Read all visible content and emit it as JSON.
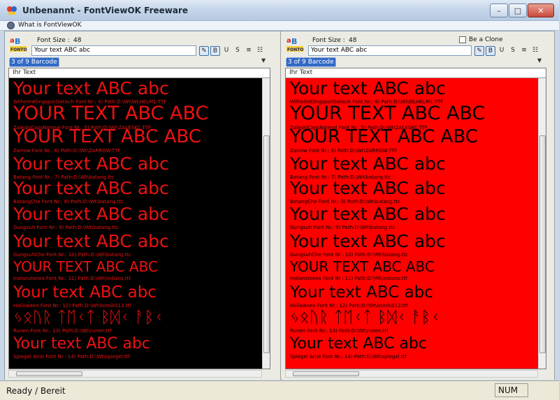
{
  "window": {
    "title": "Unbenannt - FontViewOK Freeware",
    "minimize": "–",
    "maximize": "□",
    "close": "✕"
  },
  "menu": {
    "item": "What is FontViewOK"
  },
  "logo_text": "FONTOK",
  "left": {
    "font_size_label": "Font Size :",
    "font_size_value": "48",
    "text_value": "Your text ABC abc",
    "combo_value": "3 of 9 Barcode",
    "preview_header": "Ihr Text",
    "bg": "#000000",
    "fg": "#ee1111",
    "info_color": "#ee1111"
  },
  "right": {
    "font_size_label": "Font Size :",
    "font_size_value": "48",
    "clone_label": "Be a Clone",
    "text_value": "Your text ABC abc",
    "combo_value": "3 of 9 Barcode",
    "preview_header": "Ihr Text",
    "bg": "#ff0000",
    "fg": "#000000",
    "info_color": "#000000"
  },
  "toolbar_icons": [
    "pencil-icon",
    "bold-icon",
    "underline-icon",
    "strikeout-icon",
    "format-icon",
    "grid-icon"
  ],
  "fonts": [
    {
      "sample": "Your text ABC abc",
      "info": "WilhelmKlingsporGotisch Font Nr.: 4) Path:D:\\WI\\WLHELM1.TTF"
    },
    {
      "sample": "YOUR TEXT ABC ABC",
      "info": "ZaleskiCapsNormal Font Nr.: 5) Path:D:\\Wt\\ZALESKC.TTF"
    },
    {
      "sample": "YOUR TEXT ABC ABC",
      "info": "Zarrow Font Nr.: 6) Path:D:\\Wt\\ZARROW.TTF"
    },
    {
      "sample": "Your text ABC abc",
      "info": "Batang Font Nr.: 7) Path:D:\\Wt\\batang.ttc"
    },
    {
      "sample": "Your text ABC abc",
      "info": "BatangChe Font Nr.: 8) Path:D:\\Wt\\batang.ttc"
    },
    {
      "sample": "Your text ABC abc",
      "info": "Gungsuh Font Nr.: 9) Path:D:\\Wt\\batang.ttc"
    },
    {
      "sample": "Your text ABC abc",
      "info": "GungsuhChe Font Nr.: 10) Path:D:\\Wt\\batang.ttc"
    },
    {
      "sample": "YOUR TEXT ABC ABC",
      "info": "Indianstones Font Nr.: 11) Path:D:\\Wt\\indians.ttf"
    },
    {
      "sample": "Your text ABC abc",
      "info": "Halloween Font Nr.: 12) Path:D:\\Wt\\komik013.ttf"
    },
    {
      "sample": "ᛃᛟᚢᚱ ᛏᛖᚲᛏ ᛒᛞᚲ ᚨᛒᚲ",
      "info": "Runen Font Nr.: 13) Path:D:\\Wt\\runen.ttf"
    },
    {
      "sample": "Your text ABC abc",
      "info": "Spiegel Arial Font Nr.: 14) Path:D:\\Wt\\spiegel.ttf"
    }
  ],
  "status": {
    "text": "Ready / Bereit",
    "num": "NUM"
  }
}
